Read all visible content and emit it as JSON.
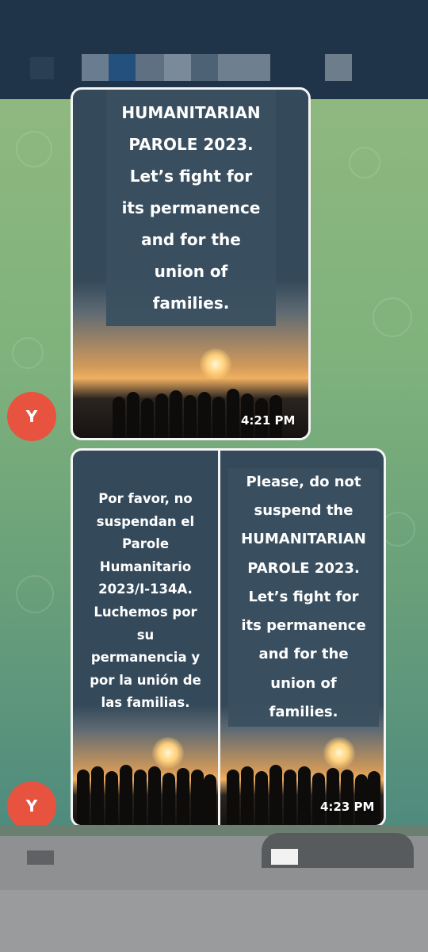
{
  "chat": {
    "message1": {
      "text": "HUMANITARIAN\nPAROLE 2023.\nLet’s fight for\nits permanence\nand for the\nunion of\nfamilies.",
      "time": "4:21 PM",
      "avatar": "Y"
    },
    "message2": {
      "left_text": "Por favor, no\nsuspendan el\nParole\nHumanitario\n2023/I-134A.\nLuchemos por\nsu\npermanencia y\npor la unión de\nlas familias.",
      "right_text": "Please, do not\nsuspend the\nHUMANITARIAN\nPAROLE 2023.\nLet’s fight for\nits permanence\nand for the\nunion of\nfamilies.",
      "time": "4:23 PM",
      "avatar": "Y"
    }
  },
  "colors": {
    "header": "#1f3448",
    "avatar": "#e8533f",
    "textbox": "#3a5060"
  }
}
